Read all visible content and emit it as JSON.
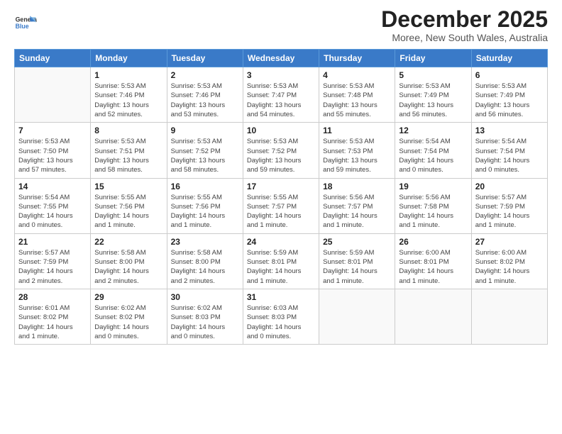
{
  "header": {
    "logo_line1": "General",
    "logo_line2": "Blue",
    "month": "December 2025",
    "location": "Moree, New South Wales, Australia"
  },
  "weekdays": [
    "Sunday",
    "Monday",
    "Tuesday",
    "Wednesday",
    "Thursday",
    "Friday",
    "Saturday"
  ],
  "weeks": [
    [
      {
        "day": "",
        "info": ""
      },
      {
        "day": "1",
        "info": "Sunrise: 5:53 AM\nSunset: 7:46 PM\nDaylight: 13 hours\nand 52 minutes."
      },
      {
        "day": "2",
        "info": "Sunrise: 5:53 AM\nSunset: 7:46 PM\nDaylight: 13 hours\nand 53 minutes."
      },
      {
        "day": "3",
        "info": "Sunrise: 5:53 AM\nSunset: 7:47 PM\nDaylight: 13 hours\nand 54 minutes."
      },
      {
        "day": "4",
        "info": "Sunrise: 5:53 AM\nSunset: 7:48 PM\nDaylight: 13 hours\nand 55 minutes."
      },
      {
        "day": "5",
        "info": "Sunrise: 5:53 AM\nSunset: 7:49 PM\nDaylight: 13 hours\nand 56 minutes."
      },
      {
        "day": "6",
        "info": "Sunrise: 5:53 AM\nSunset: 7:49 PM\nDaylight: 13 hours\nand 56 minutes."
      }
    ],
    [
      {
        "day": "7",
        "info": "Sunrise: 5:53 AM\nSunset: 7:50 PM\nDaylight: 13 hours\nand 57 minutes."
      },
      {
        "day": "8",
        "info": "Sunrise: 5:53 AM\nSunset: 7:51 PM\nDaylight: 13 hours\nand 58 minutes."
      },
      {
        "day": "9",
        "info": "Sunrise: 5:53 AM\nSunset: 7:52 PM\nDaylight: 13 hours\nand 58 minutes."
      },
      {
        "day": "10",
        "info": "Sunrise: 5:53 AM\nSunset: 7:52 PM\nDaylight: 13 hours\nand 59 minutes."
      },
      {
        "day": "11",
        "info": "Sunrise: 5:53 AM\nSunset: 7:53 PM\nDaylight: 13 hours\nand 59 minutes."
      },
      {
        "day": "12",
        "info": "Sunrise: 5:54 AM\nSunset: 7:54 PM\nDaylight: 14 hours\nand 0 minutes."
      },
      {
        "day": "13",
        "info": "Sunrise: 5:54 AM\nSunset: 7:54 PM\nDaylight: 14 hours\nand 0 minutes."
      }
    ],
    [
      {
        "day": "14",
        "info": "Sunrise: 5:54 AM\nSunset: 7:55 PM\nDaylight: 14 hours\nand 0 minutes."
      },
      {
        "day": "15",
        "info": "Sunrise: 5:55 AM\nSunset: 7:56 PM\nDaylight: 14 hours\nand 1 minute."
      },
      {
        "day": "16",
        "info": "Sunrise: 5:55 AM\nSunset: 7:56 PM\nDaylight: 14 hours\nand 1 minute."
      },
      {
        "day": "17",
        "info": "Sunrise: 5:55 AM\nSunset: 7:57 PM\nDaylight: 14 hours\nand 1 minute."
      },
      {
        "day": "18",
        "info": "Sunrise: 5:56 AM\nSunset: 7:57 PM\nDaylight: 14 hours\nand 1 minute."
      },
      {
        "day": "19",
        "info": "Sunrise: 5:56 AM\nSunset: 7:58 PM\nDaylight: 14 hours\nand 1 minute."
      },
      {
        "day": "20",
        "info": "Sunrise: 5:57 AM\nSunset: 7:59 PM\nDaylight: 14 hours\nand 1 minute."
      }
    ],
    [
      {
        "day": "21",
        "info": "Sunrise: 5:57 AM\nSunset: 7:59 PM\nDaylight: 14 hours\nand 2 minutes."
      },
      {
        "day": "22",
        "info": "Sunrise: 5:58 AM\nSunset: 8:00 PM\nDaylight: 14 hours\nand 2 minutes."
      },
      {
        "day": "23",
        "info": "Sunrise: 5:58 AM\nSunset: 8:00 PM\nDaylight: 14 hours\nand 2 minutes."
      },
      {
        "day": "24",
        "info": "Sunrise: 5:59 AM\nSunset: 8:01 PM\nDaylight: 14 hours\nand 1 minute."
      },
      {
        "day": "25",
        "info": "Sunrise: 5:59 AM\nSunset: 8:01 PM\nDaylight: 14 hours\nand 1 minute."
      },
      {
        "day": "26",
        "info": "Sunrise: 6:00 AM\nSunset: 8:01 PM\nDaylight: 14 hours\nand 1 minute."
      },
      {
        "day": "27",
        "info": "Sunrise: 6:00 AM\nSunset: 8:02 PM\nDaylight: 14 hours\nand 1 minute."
      }
    ],
    [
      {
        "day": "28",
        "info": "Sunrise: 6:01 AM\nSunset: 8:02 PM\nDaylight: 14 hours\nand 1 minute."
      },
      {
        "day": "29",
        "info": "Sunrise: 6:02 AM\nSunset: 8:02 PM\nDaylight: 14 hours\nand 0 minutes."
      },
      {
        "day": "30",
        "info": "Sunrise: 6:02 AM\nSunset: 8:03 PM\nDaylight: 14 hours\nand 0 minutes."
      },
      {
        "day": "31",
        "info": "Sunrise: 6:03 AM\nSunset: 8:03 PM\nDaylight: 14 hours\nand 0 minutes."
      },
      {
        "day": "",
        "info": ""
      },
      {
        "day": "",
        "info": ""
      },
      {
        "day": "",
        "info": ""
      }
    ]
  ]
}
